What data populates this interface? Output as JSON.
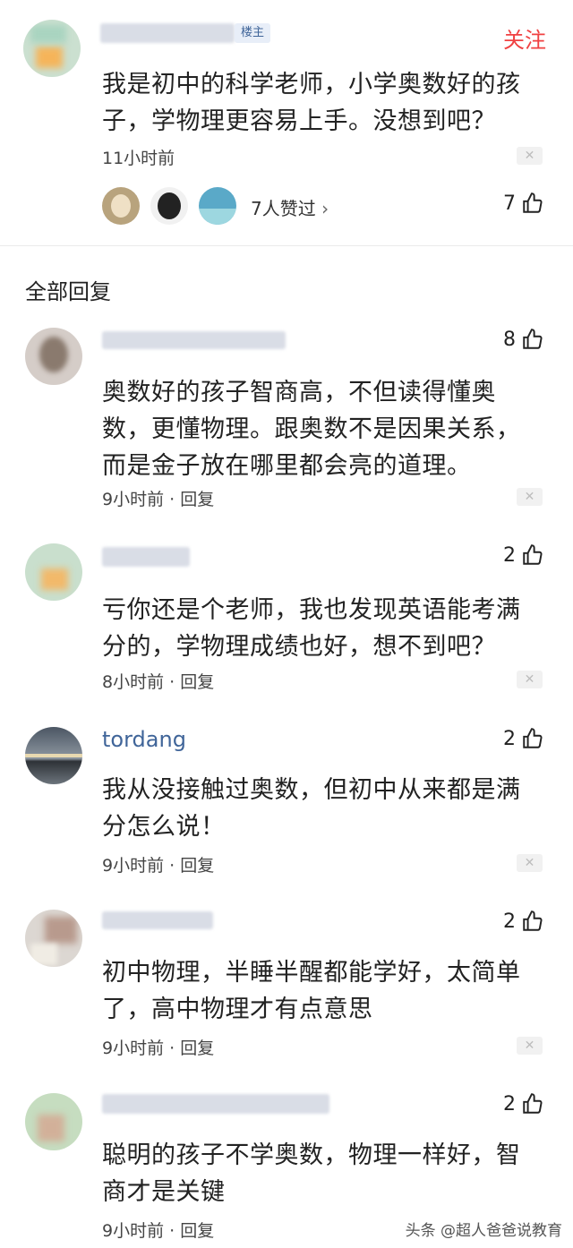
{
  "op": {
    "badge": "楼主",
    "follow": "关注",
    "text": "我是初中的科学老师，小学奥数好的孩子，学物理更容易上手。没想到吧？",
    "time": "11小时前",
    "likers_text": "7人赞过",
    "like_count": "7"
  },
  "section_title": "全部回复",
  "replies": [
    {
      "name": "",
      "likes": "8",
      "text": "奥数好的孩子智商高，不但读得懂奥数，更懂物理。跟奥数不是因果关系，而是金子放在哪里都会亮的道理。",
      "meta": "9小时前 · 回复"
    },
    {
      "name": "",
      "likes": "2",
      "text": "亏你还是个老师，我也发现英语能考满分的，学物理成绩也好，想不到吧？",
      "meta": "8小时前 · 回复"
    },
    {
      "name": "tordang",
      "likes": "2",
      "text": "我从没接触过奥数，但初中从来都是满分怎么说！",
      "meta": "9小时前 · 回复"
    },
    {
      "name": "",
      "likes": "2",
      "text": "初中物理，半睡半醒都能学好，太简单了，高中物理才有点意思",
      "meta": "9小时前 · 回复"
    },
    {
      "name": "",
      "likes": "2",
      "text": "聪明的孩子不学奥数，物理一样好，智商才是关键",
      "meta": "9小时前 · 回复"
    }
  ],
  "watermark": "头条 @超人爸爸说教育",
  "colors": {
    "follow": "#f04142",
    "username": "#406599",
    "badge_bg": "#e8eef8"
  }
}
